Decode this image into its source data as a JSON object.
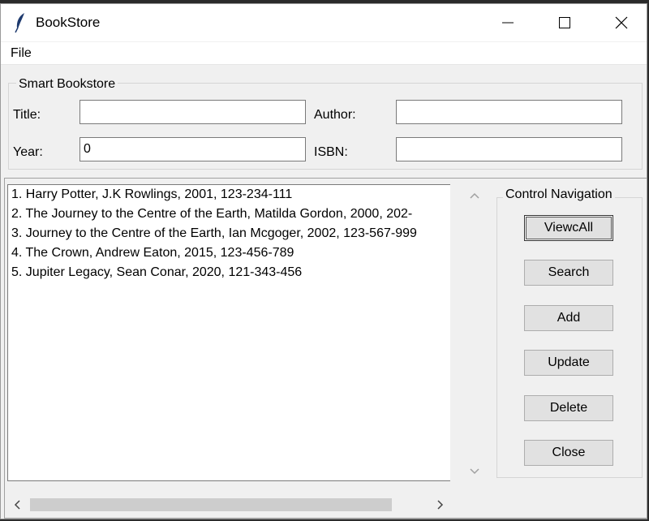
{
  "window": {
    "title": "BookStore",
    "controls": {
      "minimize": "minimize-icon",
      "maximize": "maximize-icon",
      "close": "close-icon"
    }
  },
  "menu": {
    "file_label": "File"
  },
  "form": {
    "group_label": "Smart Bookstore",
    "title_label": "Title:",
    "author_label": "Author:",
    "year_label": "Year:",
    "isbn_label": "ISBN:",
    "title_value": "",
    "author_value": "",
    "year_value": "0",
    "isbn_value": ""
  },
  "results": {
    "items": [
      "1. Harry Potter, J.K Rowlings, 2001, 123-234-111",
      "2. The Journey to the Centre of the Earth, Matilda Gordon, 2000, 202-",
      "3. Journey to the Centre of the Earth, Ian Mcgoger, 2002, 123-567-999",
      "4. The Crown, Andrew Eaton, 2015, 123-456-789",
      "5. Jupiter Legacy, Sean Conar, 2020, 121-343-456"
    ],
    "scrollbar_h_fraction": 0.86
  },
  "nav": {
    "group_label": "Control Navigation",
    "buttons": [
      "ViewcAll",
      "Search",
      "Add",
      "Update",
      "Delete",
      "Close"
    ]
  },
  "colors": {
    "window_bg": "#f0f0f0",
    "titlebar_bg": "#ffffff",
    "button_bg": "#e1e1e1",
    "feather": "#1e3a6e"
  }
}
